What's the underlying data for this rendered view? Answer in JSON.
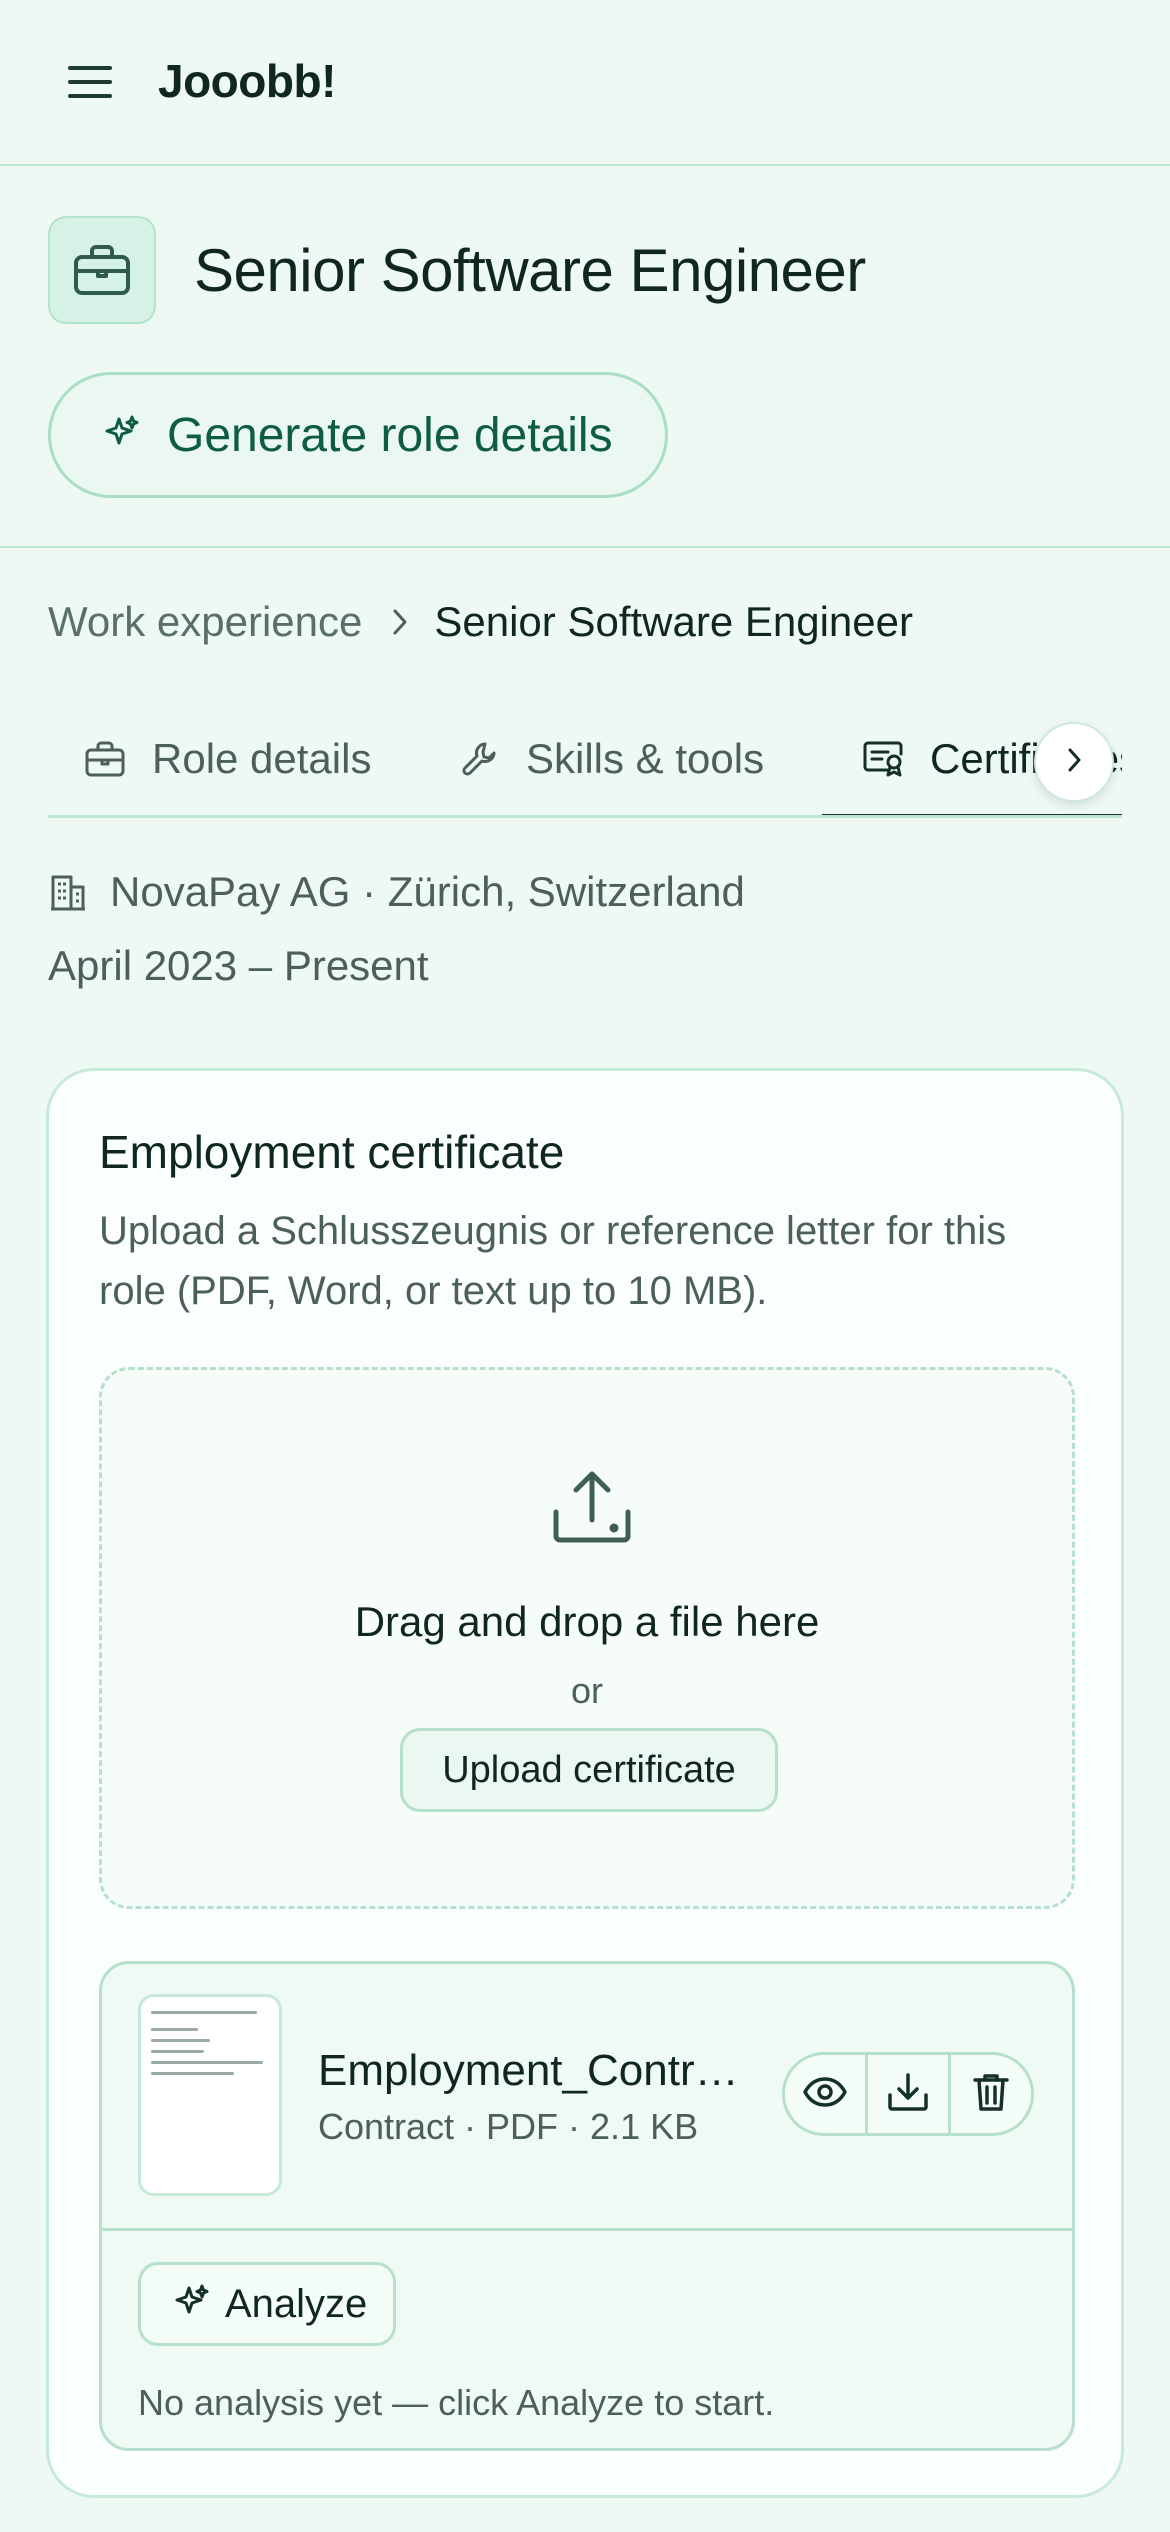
{
  "app": {
    "brand": "Jooobb!"
  },
  "role": {
    "title": "Senior Software Engineer",
    "generate_label": "Generate role details"
  },
  "breadcrumb": {
    "parent": "Work experience",
    "current": "Senior Software Engineer"
  },
  "tabs": [
    {
      "label": "Role details",
      "icon": "briefcase-icon"
    },
    {
      "label": "Skills & tools",
      "icon": "wrench-icon"
    },
    {
      "label": "Certificates",
      "icon": "certificate-icon",
      "active": true
    }
  ],
  "meta": {
    "company_line": "NovaPay AG · Zürich, Switzerland",
    "date_range": "April 2023 – Present"
  },
  "certificate_card": {
    "title": "Employment certificate",
    "description": "Upload a Schlusszeugnis or reference letter for this role (PDF, Word, or text up to 10 MB).",
    "dropzone_main": "Drag and drop a file here",
    "dropzone_or": "or",
    "upload_label": "Upload certificate"
  },
  "file": {
    "name": "Employment_Contract.pdf",
    "meta": "Contract · PDF · 2.1 KB",
    "analyze_label": "Analyze",
    "analysis_status": "No analysis yet — click Analyze to start."
  },
  "colors": {
    "background": "#eef9f3",
    "accent": "#0f5c45",
    "border": "#bfe6d4",
    "text": "#0f2621"
  }
}
